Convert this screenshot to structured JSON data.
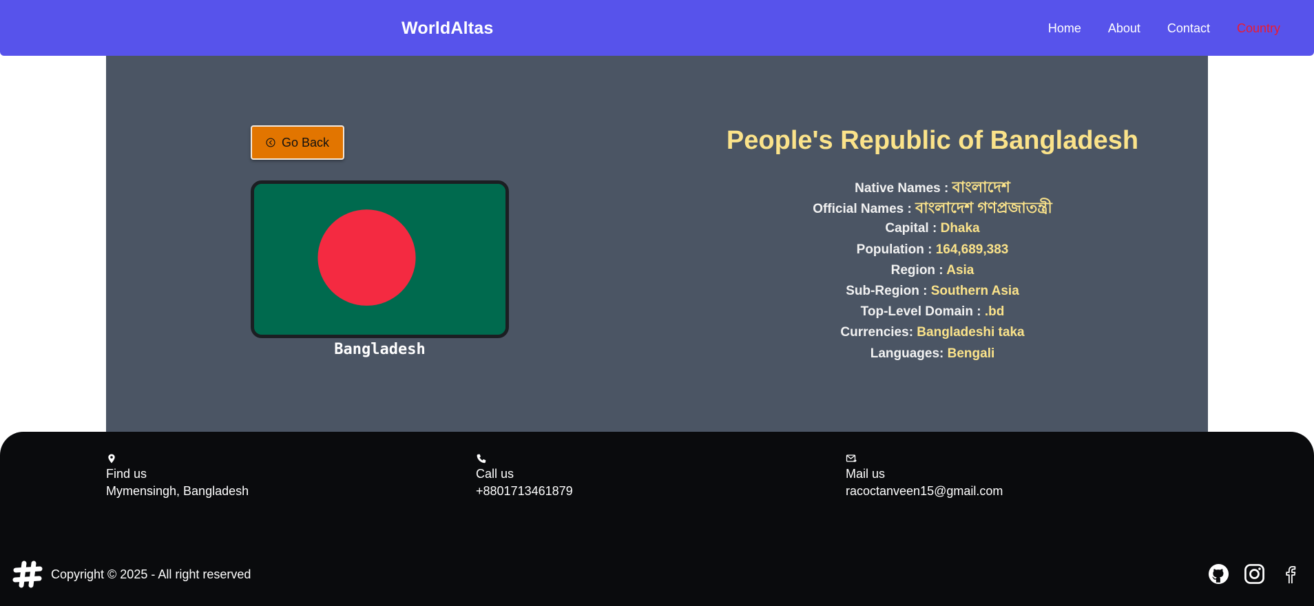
{
  "header": {
    "brand": "WorldAltas",
    "nav": [
      {
        "label": "Home"
      },
      {
        "label": "About"
      },
      {
        "label": "Contact"
      },
      {
        "label": "Country",
        "active": true
      }
    ],
    "accent_color": "#5753eb",
    "active_color": "#ef1a2d"
  },
  "country": {
    "go_back_label": "Go Back",
    "go_back_icon": "circle-chevron-left-icon",
    "flag_colors": {
      "field": "#006a4e",
      "disc": "#f42a41"
    },
    "common_name": "Bangladesh",
    "official_title": "People's Republic of Bangladesh",
    "details": [
      {
        "label": "Native Names : ",
        "value": "বাংলাদেশ",
        "big": true
      },
      {
        "label": "Official Names : ",
        "value": "বাংলাদেশ গণপ্রজাতন্ত্রী",
        "big": true
      },
      {
        "label": "Capital : ",
        "value": "Dhaka"
      },
      {
        "label": "Population : ",
        "value": "164,689,383"
      },
      {
        "label": "Region : ",
        "value": "Asia"
      },
      {
        "label": "Sub-Region : ",
        "value": "Southern Asia"
      },
      {
        "label": "Top-Level Domain : ",
        "value": ".bd"
      },
      {
        "label": "Currencies: ",
        "value": "Bangladeshi taka"
      },
      {
        "label": "Languages: ",
        "value": "Bengali"
      }
    ]
  },
  "footer": {
    "contacts": [
      {
        "icon": "map-pin-icon",
        "title": "Find us",
        "text": "Mymensingh, Bangladesh"
      },
      {
        "icon": "phone-icon",
        "title": "Call us",
        "text": "+8801713461879"
      },
      {
        "icon": "mail-icon",
        "title": "Mail us",
        "text": "racoctanveen15@gmail.com"
      }
    ],
    "copyright": "Copyright © 2025 - All right reserved",
    "logo_icon": "hash-logo-icon",
    "socials": [
      "github-icon",
      "instagram-icon",
      "facebook-icon"
    ]
  }
}
